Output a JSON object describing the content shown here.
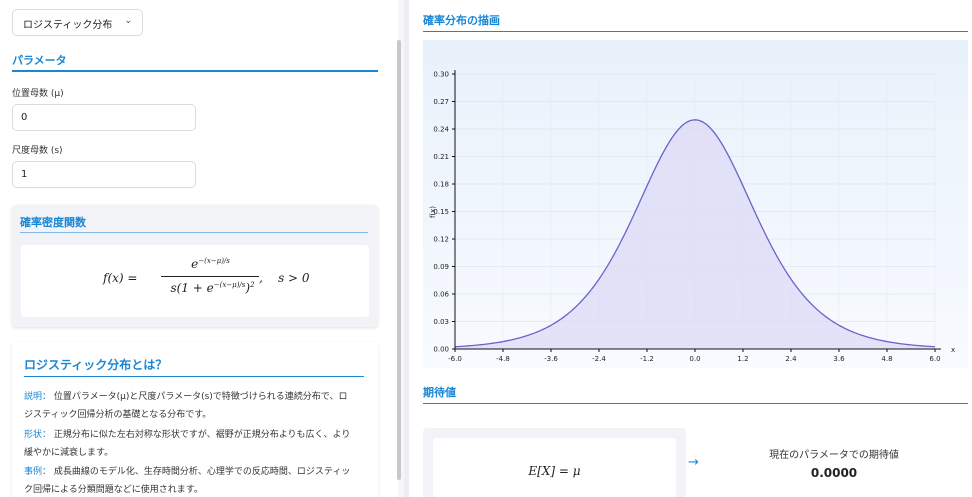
{
  "distribution_select": {
    "value": "ロジスティック分布",
    "chevron_icon": "chevron-down-icon"
  },
  "params": {
    "title": "パラメータ",
    "location_label": "位置母数 (μ)",
    "location_value": "0",
    "scale_label": "尺度母数 (s)",
    "scale_value": "1"
  },
  "pdf": {
    "title": "確率密度関数",
    "lhs": "f(x) =",
    "numerator": "e",
    "numerator_exp": "−(x−μ)/s",
    "denominator_pre": "s(1 + e",
    "denominator_exp": "−(x−μ)/s",
    "denominator_post": ")",
    "denominator_sq": "2",
    "condition": ",    s > 0"
  },
  "about": {
    "title": "ロジスティック分布とは？",
    "items": [
      {
        "key": "説明：",
        "line1": "位置パラメータ(μ)と尺度パラメータ(s)で特徴づけられる連続分布で、ロ",
        "line2": "ジスティック回帰分析の基礎となる分布です。"
      },
      {
        "key": "形状：",
        "line1": "正規分布に似た左右対称な形状ですが、裾野が正規分布よりも広く、より",
        "line2": "緩やかに減衰します。"
      },
      {
        "key": "事例：",
        "line1": "成長曲線のモデル化、生存時間分析、心理学での反応時間、ロジスティッ",
        "line2": "ク回帰による分類問題などに使用されます。"
      }
    ]
  },
  "plot_section": {
    "title": "確率分布の描画"
  },
  "expectation": {
    "title": "期待値",
    "formula": "E[X] = μ",
    "arrow": "→",
    "label": "現在のパラメータでの期待値",
    "value": "0.0000"
  },
  "chart_data": {
    "type": "area",
    "title": "",
    "xlabel": "x",
    "ylabel": "f(x)",
    "xlim": [
      -6.0,
      6.0
    ],
    "ylim": [
      0.0,
      0.3
    ],
    "x_ticks": [
      "-6.0",
      "-4.8",
      "-3.6",
      "-2.4",
      "-1.2",
      "0.0",
      "1.2",
      "2.4",
      "3.6",
      "4.8",
      "6.0"
    ],
    "y_ticks": [
      "0.00",
      "0.03",
      "0.06",
      "0.09",
      "0.12",
      "0.15",
      "0.18",
      "0.21",
      "0.24",
      "0.27",
      "0.30"
    ],
    "series": [
      {
        "x": [
          -6.0,
          -5.0,
          -4.0,
          -3.0,
          -2.4,
          -2.0,
          -1.5,
          -1.0,
          -0.5,
          0.0,
          0.5,
          1.0,
          1.5,
          2.0,
          2.4,
          3.0,
          4.0,
          5.0,
          6.0
        ],
        "y": [
          0.0025,
          0.0066,
          0.0177,
          0.0452,
          0.0761,
          0.105,
          0.149,
          0.197,
          0.235,
          0.25,
          0.235,
          0.197,
          0.149,
          0.105,
          0.0761,
          0.0452,
          0.0177,
          0.0066,
          0.0025
        ]
      }
    ],
    "grid": true,
    "colors": {
      "line": "#6a63c9",
      "fill": "#dcd9f6"
    }
  }
}
